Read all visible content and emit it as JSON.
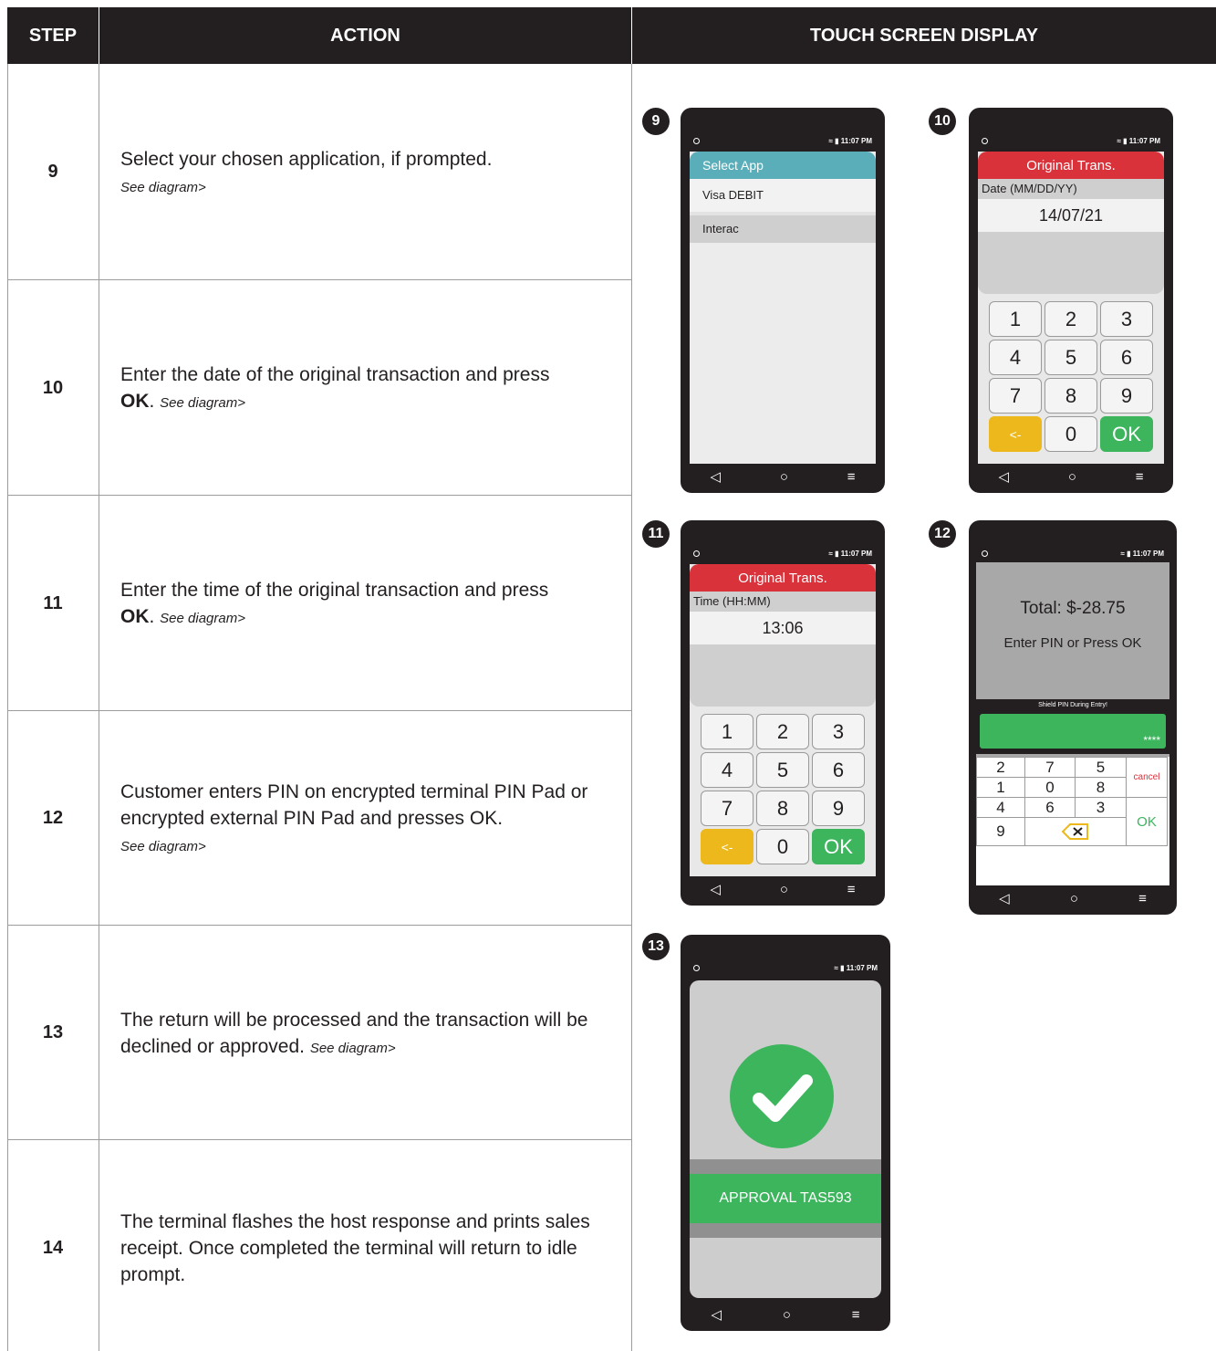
{
  "header": {
    "step": "STEP",
    "action": "ACTION",
    "display": "TOUCH SCREEN DISPLAY"
  },
  "steps": [
    {
      "num": "9",
      "text": "Select your chosen application, if prompted.",
      "see": "See diagram>"
    },
    {
      "num": "10",
      "text": "Enter the date of the original transaction and press",
      "bold": "OK",
      "see": "See diagram>"
    },
    {
      "num": "11",
      "text": "Enter the time of the original transaction and press",
      "bold": "OK",
      "see": "See diagram>"
    },
    {
      "num": "12",
      "text": "Customer enters PIN on encrypted terminal PIN Pad or encrypted external PIN Pad and presses OK.",
      "see": "See diagram>"
    },
    {
      "num": "13",
      "text": "The return will be processed and the transaction will be declined or approved.",
      "see": "See diagram>"
    },
    {
      "num": "14",
      "text": "The terminal flashes the host response and prints sales receipt. Once completed the terminal will return to idle prompt."
    }
  ],
  "status_time": "11:07 PM",
  "nav_icons": [
    "back-icon",
    "home-icon",
    "menu-icon"
  ],
  "screen9": {
    "badge": "9",
    "title": "Select App",
    "items": [
      "Visa DEBIT",
      "Interac"
    ]
  },
  "screen10": {
    "badge": "10",
    "title": "Original Trans.",
    "label": "Date (MM/DD/YY)",
    "value": "14/07/21"
  },
  "screen11": {
    "badge": "11",
    "title": "Original Trans.",
    "label": "Time (HH:MM)",
    "value": "13:06"
  },
  "keypad": {
    "keys": [
      "1",
      "2",
      "3",
      "4",
      "5",
      "6",
      "7",
      "8",
      "9",
      "<-",
      "0",
      "OK"
    ]
  },
  "screen12": {
    "badge": "12",
    "total": "Total: $-28.75",
    "prompt": "Enter PIN or Press OK",
    "shield": "Shield PIN During Entry!",
    "masked": "****",
    "digits": [
      "2",
      "7",
      "5",
      "1",
      "0",
      "8",
      "4",
      "6",
      "3",
      "9"
    ],
    "cancel": "cancel",
    "ok": "OK"
  },
  "screen13": {
    "badge": "13",
    "approval": "APPROVAL TAS593"
  },
  "colors": {
    "red": "#d9323b",
    "teal": "#5aaeb9",
    "green": "#3cb55d",
    "yellow": "#ecb81b",
    "dark": "#231f20"
  }
}
